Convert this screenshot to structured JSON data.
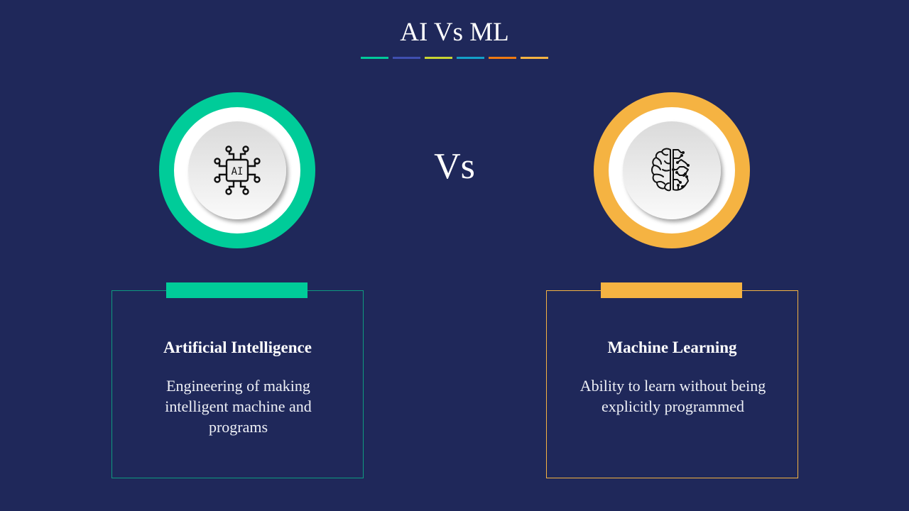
{
  "slide": {
    "title": "AI Vs ML",
    "divider_colors": [
      "#00c99a",
      "#3f4fb0",
      "#c8d432",
      "#14a0c8",
      "#f07a12",
      "#f5b342"
    ],
    "vs_label": "Vs",
    "colors": {
      "background": "#1f285a",
      "ai_accent": "#00cc99",
      "ml_accent": "#f5b342"
    }
  },
  "left": {
    "icon": "ai-chip-icon",
    "icon_text": "AI",
    "heading": "Artificial Intelligence",
    "description": "Engineering of making intelligent machine and programs"
  },
  "right": {
    "icon": "brain-circuit-icon",
    "heading": "Machine Learning",
    "description": "Ability to learn without being explicitly programmed"
  }
}
